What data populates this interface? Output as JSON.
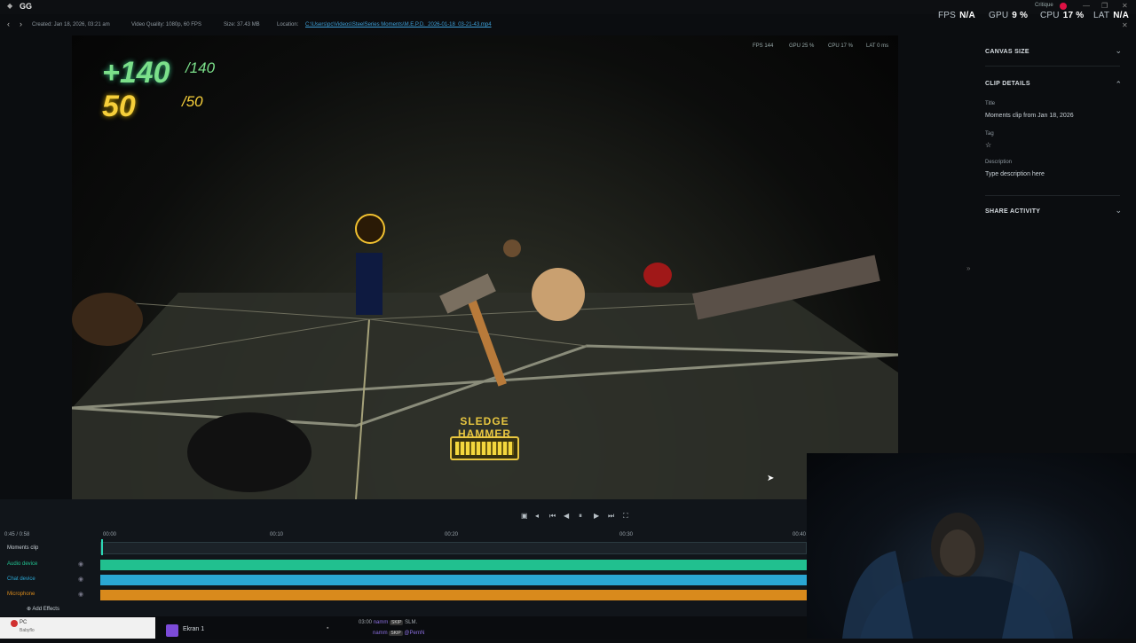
{
  "app": {
    "title": "GG"
  },
  "perf": {
    "fps_label": "FPS",
    "fps_value": "N/A",
    "gpu_label": "GPU",
    "gpu_value": "9 %",
    "cpu_label": "CPU",
    "cpu_value": "17 %",
    "lat_label": "LAT",
    "lat_value": "N/A",
    "user": "Critique"
  },
  "clip_info": {
    "created": "Created:  Jan 18, 2026, 03:21 am",
    "quality": "Video Quality:  1080p, 60 FPS",
    "size": "Size:  37.43 MB",
    "location_label": "Location:",
    "location_path": "C:\\Users\\pc\\Videos\\SteelSeries Moments\\M.E.P.D._2026-01-18_03-21-43.mp4"
  },
  "video_overlay": {
    "fps": "FPS 144",
    "gpu": "GPU 25 %",
    "cpu": "CPU 17 %",
    "lat": "LAT 0 ms"
  },
  "hud": {
    "health": "+140",
    "health_max": "/140",
    "energy": "50",
    "energy_max": "/50",
    "weapon": "SLEDGE HAMMER"
  },
  "panel": {
    "canvas_size": "CANVAS SIZE",
    "clip_details": "CLIP DETAILS",
    "title_label": "Title",
    "title_value": "Moments clip from Jan 18, 2026",
    "tag_label": "Tag",
    "description_label": "Description",
    "description_placeholder": "Type description here",
    "share_activity": "SHARE ACTIVITY"
  },
  "timeline": {
    "position": "0:45 / 0:58",
    "ticks": [
      "00:00",
      "00:10",
      "00:20",
      "00:30",
      "00:40"
    ],
    "tracks": [
      {
        "name": "Moments clip",
        "color": "#c7ced4"
      },
      {
        "name": "Audio device",
        "color": "#21c08f"
      },
      {
        "name": "Chat device",
        "color": "#2aa6d2"
      },
      {
        "name": "Microphone",
        "color": "#d98a1c"
      }
    ],
    "add_effects": "Add Effects"
  },
  "taskbar": {
    "pc_label": "PC",
    "pc_sub": "Babyflo",
    "window_label": "Ekran 1",
    "chat": [
      {
        "time": "03:00",
        "user": "namm",
        "badge": "SKIP",
        "msg": "SLM."
      },
      {
        "time": "",
        "user": "namm",
        "badge": "SKIP",
        "msg": "@PernN"
      }
    ]
  },
  "colors": {
    "accent": "#2cd6b4",
    "link": "#3ea0d8",
    "health": "#7be08a",
    "energy": "#f6cf3a"
  }
}
